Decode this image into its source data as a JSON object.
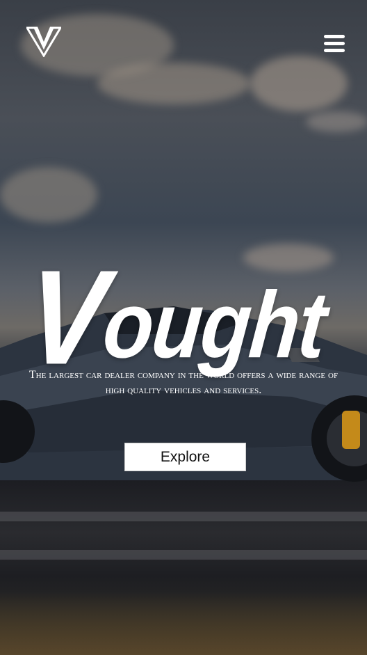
{
  "header": {
    "logo_icon": "v-logo-icon",
    "menu_icon": "hamburger-menu-icon"
  },
  "hero": {
    "brand_first": "V",
    "brand_rest": "ought",
    "tagline_line1": "The largest car dealer company in the world offers a wide range of",
    "tagline_line2": "high quality vehicles and services.",
    "explore_label": "Explore"
  },
  "colors": {
    "text": "#ffffff",
    "button_bg": "#ffffff",
    "button_text": "#111111"
  }
}
